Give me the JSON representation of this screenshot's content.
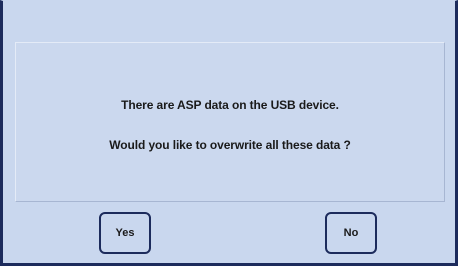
{
  "dialog": {
    "message_line_1": "There are ASP data on the USB device.",
    "message_line_2": "Would you like to overwrite all these data ?",
    "yes_label": "Yes",
    "no_label": "No"
  },
  "colors": {
    "background": "#c9d7ee",
    "border": "#1c2b5c",
    "text": "#1a1a1a"
  }
}
